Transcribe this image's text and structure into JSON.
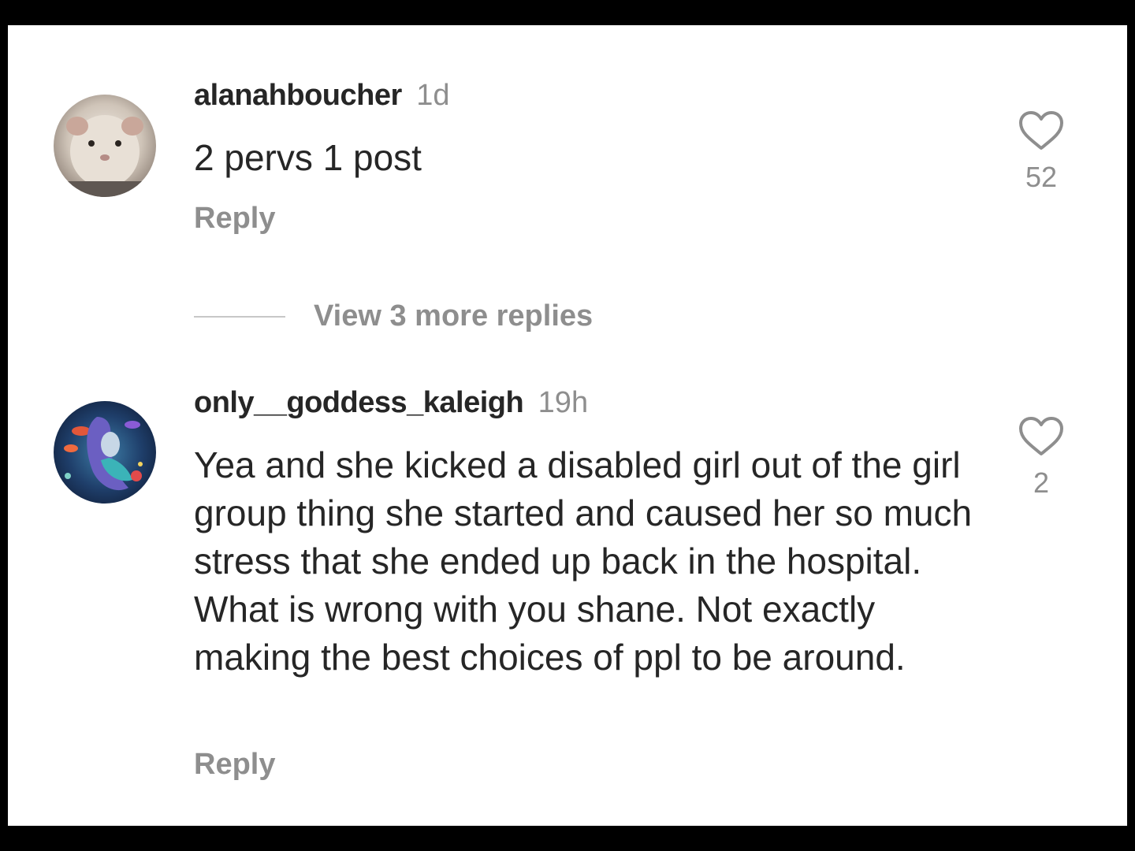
{
  "comments": [
    {
      "username": "alanahboucher",
      "time": "1d",
      "text": "2 pervs 1 post",
      "reply_label": "Reply",
      "likes": "52",
      "avatar_icon": "hamster-avatar"
    },
    {
      "username": "only__goddess_kaleigh",
      "time": "19h",
      "text": "Yea and she kicked a disabled girl out of the girl group thing she started and caused her so much stress that she ended up back in the hospital. What is wrong with you shane. Not exactly making the best choices of ppl to be around.",
      "reply_label": "Reply",
      "likes": "2",
      "avatar_icon": "mermaid-avatar"
    }
  ],
  "view_replies": {
    "label": "View 3 more replies"
  },
  "colors": {
    "primary_text": "#262626",
    "secondary_text": "#8e8e8e",
    "background": "#ffffff",
    "frame": "#000000"
  }
}
